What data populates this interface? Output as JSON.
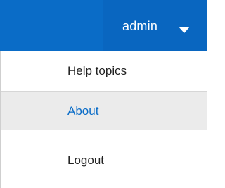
{
  "header": {
    "user_label": "admin",
    "accent_color": "#0a6cc7"
  },
  "menu": {
    "items": [
      {
        "label": "Help topics"
      },
      {
        "label": "About"
      },
      {
        "label": "Logout"
      }
    ]
  }
}
